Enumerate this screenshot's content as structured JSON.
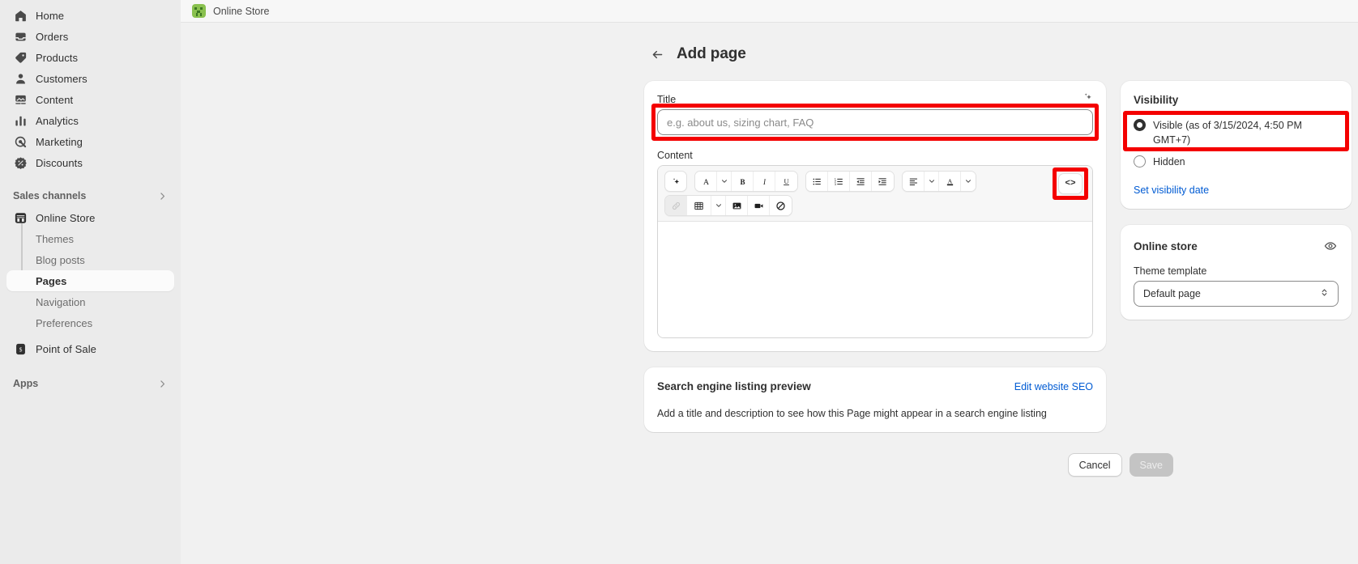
{
  "topbar": {
    "store_name": "Online Store",
    "favicon_colors": {
      "bg": "#8ac14f",
      "fg": "#3c7722"
    }
  },
  "sidebar": {
    "nav": [
      {
        "label": "Home",
        "icon": "home-icon"
      },
      {
        "label": "Orders",
        "icon": "orders-icon"
      },
      {
        "label": "Products",
        "icon": "products-icon"
      },
      {
        "label": "Customers",
        "icon": "customers-icon"
      },
      {
        "label": "Content",
        "icon": "content-icon"
      },
      {
        "label": "Analytics",
        "icon": "analytics-icon"
      },
      {
        "label": "Marketing",
        "icon": "marketing-icon"
      },
      {
        "label": "Discounts",
        "icon": "discounts-icon"
      }
    ],
    "sales_channels": {
      "label": "Sales channels",
      "chevron": "chevron-right-icon",
      "channels": [
        {
          "label": "Online Store",
          "icon": "store-icon"
        },
        {
          "label": "Point of Sale",
          "icon": "point-of-sale-icon"
        }
      ],
      "sub_items": [
        {
          "label": "Themes",
          "active": false
        },
        {
          "label": "Blog posts",
          "active": false
        },
        {
          "label": "Pages",
          "active": true
        },
        {
          "label": "Navigation",
          "active": false
        },
        {
          "label": "Preferences",
          "active": false
        }
      ]
    },
    "apps": {
      "label": "Apps",
      "chevron": "chevron-right-icon"
    }
  },
  "page": {
    "back_arrow": "arrow-left-icon",
    "title": "Add page"
  },
  "title_card": {
    "title_label": "Title",
    "title_placeholder": "e.g. about us, sizing chart, FAQ",
    "title_value": "",
    "sparkle_icon": "magic-sparkle-icon",
    "content_label": "Content",
    "editor_body_text": "",
    "toolbar": {
      "row1": [
        {
          "name": "ai-sparkle-button",
          "glyph": "sparkle-icon",
          "group": "single"
        },
        {
          "name": "font-style-button",
          "glyph": "text-style-icon",
          "group": "a"
        },
        {
          "name": "font-style-dropdown",
          "glyph": "chevron-down-icon",
          "group": "a"
        },
        {
          "name": "bold-button",
          "glyph": "bold-icon",
          "group": "a"
        },
        {
          "name": "italic-button",
          "glyph": "italic-icon",
          "group": "a"
        },
        {
          "name": "underline-button",
          "glyph": "underline-icon",
          "group": "a"
        },
        {
          "name": "bulleted-list-button",
          "glyph": "bulleted-list-icon",
          "group": "b"
        },
        {
          "name": "numbered-list-button",
          "glyph": "numbered-list-icon",
          "group": "b"
        },
        {
          "name": "outdent-button",
          "glyph": "outdent-icon",
          "group": "b"
        },
        {
          "name": "indent-button",
          "glyph": "indent-icon",
          "group": "b"
        },
        {
          "name": "align-button",
          "glyph": "align-left-icon",
          "group": "c"
        },
        {
          "name": "align-dropdown",
          "glyph": "chevron-down-icon",
          "group": "c"
        },
        {
          "name": "text-color-button",
          "glyph": "text-color-icon",
          "group": "c"
        },
        {
          "name": "text-color-dropdown",
          "glyph": "chevron-down-icon",
          "group": "c"
        }
      ],
      "row2": [
        {
          "name": "insert-link-button",
          "glyph": "link-icon",
          "disabled": true
        },
        {
          "name": "insert-table-button",
          "glyph": "table-icon",
          "disabled": false
        },
        {
          "name": "table-dropdown",
          "glyph": "chevron-down-icon",
          "disabled": false
        },
        {
          "name": "insert-image-button",
          "glyph": "image-icon",
          "disabled": false
        },
        {
          "name": "insert-video-button",
          "glyph": "video-icon",
          "disabled": false
        },
        {
          "name": "clear-formatting-button",
          "glyph": "no-symbol-icon",
          "disabled": false
        }
      ],
      "code_button_label": "<>"
    }
  },
  "seo_card": {
    "heading": "Search engine listing preview",
    "edit_link": "Edit website SEO",
    "description": "Add a title and description to see how this Page might appear in a search engine listing"
  },
  "visibility_card": {
    "heading": "Visibility",
    "options": [
      {
        "label": "Visible (as of 3/15/2024, 4:50 PM GMT+7)",
        "selected": true
      },
      {
        "label": "Hidden",
        "selected": false
      }
    ],
    "set_date_link": "Set visibility date"
  },
  "online_store_card": {
    "heading": "Online store",
    "eye_icon": "eye-icon",
    "theme_template_label": "Theme template",
    "theme_template_value": "Default page"
  },
  "footer": {
    "cancel_label": "Cancel",
    "save_label": "Save",
    "save_disabled": true
  },
  "annotations": {
    "color": "#f40000",
    "boxes": [
      "title-input-highlight",
      "code-button-highlight",
      "visible-radio-highlight"
    ]
  }
}
